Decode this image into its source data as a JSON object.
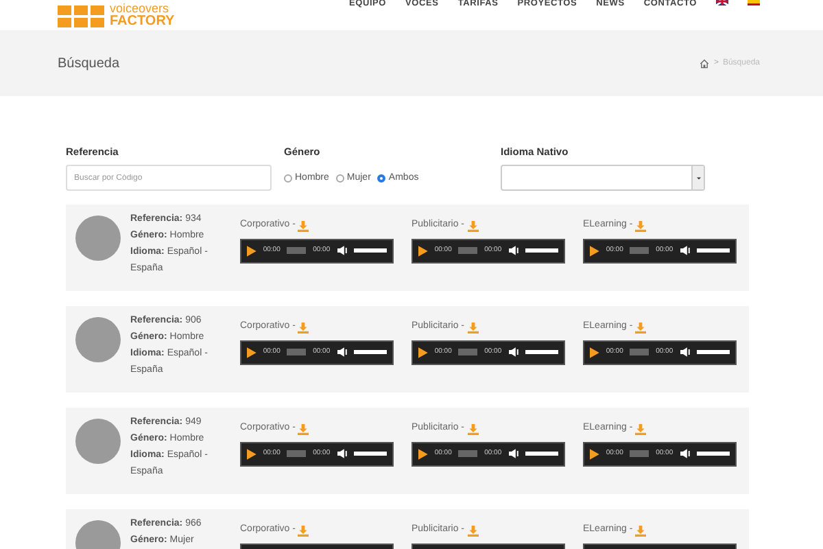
{
  "header": {
    "logo": {
      "line1": "voiceovers",
      "line2": "FACTORY"
    },
    "nav": [
      {
        "label": "EQUIPO"
      },
      {
        "label": "VOCES"
      },
      {
        "label": "TARIFAS"
      },
      {
        "label": "PROYECTOS"
      },
      {
        "label": "NEWS"
      },
      {
        "label": "CONTACTO"
      }
    ]
  },
  "page_title": "Búsqueda",
  "breadcrumb": {
    "separator": ">",
    "current": "Búsqueda"
  },
  "filters": {
    "referencia": {
      "label": "Referencia",
      "placeholder": "Buscar por Código"
    },
    "genero": {
      "label": "Género",
      "options": [
        {
          "label": "Hombre",
          "selected": false
        },
        {
          "label": "Mujer",
          "selected": false
        },
        {
          "label": "Ambos",
          "selected": true
        }
      ]
    },
    "idioma": {
      "label": "Idioma Nativo"
    }
  },
  "voices": [
    {
      "lines": [
        "**Referencia:** 934",
        "**Género:** Hombre",
        "**Idioma:** Español - España"
      ],
      "samples": [
        {
          "label": "Corporativo -",
          "current": "00:00",
          "duration": "00:00",
          "progress": {
            "level": 0
          },
          "volume": {
            "level": 1
          }
        },
        {
          "label": "Publicitario -",
          "current": "00:00",
          "duration": "00:00",
          "progress": {
            "level": 0
          },
          "volume": {
            "level": 1
          }
        },
        {
          "label": "ELearning -",
          "current": "00:00",
          "duration": "00:00",
          "progress": {
            "level": 0
          },
          "volume": {
            "level": 1
          }
        }
      ]
    },
    {
      "lines": [
        "**Referencia:** 906",
        "**Género:** Hombre",
        "**Idioma:** Español - España"
      ],
      "samples": [
        {
          "label": "Corporativo -",
          "current": "00:00",
          "duration": "00:00",
          "progress": {
            "level": 0
          },
          "volume": {
            "level": 1
          }
        },
        {
          "label": "Publicitario -",
          "current": "00:00",
          "duration": "00:00",
          "progress": {
            "level": 0
          },
          "volume": {
            "level": 1
          }
        },
        {
          "label": "ELearning -",
          "current": "00:00",
          "duration": "00:00",
          "progress": {
            "level": 0
          },
          "volume": {
            "level": 1
          }
        }
      ]
    },
    {
      "lines": [
        "**Referencia:** 949",
        "**Género:** Hombre",
        "**Idioma:** Español - España"
      ],
      "samples": [
        {
          "label": "Corporativo -",
          "current": "00:00",
          "duration": "00:00",
          "progress": {
            "level": 0
          },
          "volume": {
            "level": 1
          }
        },
        {
          "label": "Publicitario -",
          "current": "00:00",
          "duration": "00:00",
          "progress": {
            "level": 0
          },
          "volume": {
            "level": 1
          }
        },
        {
          "label": "ELearning -",
          "current": "00:00",
          "duration": "00:00",
          "progress": {
            "level": 0
          },
          "volume": {
            "level": 1
          }
        }
      ]
    },
    {
      "lines": [
        "**Referencia:** 966",
        "**Género:** Mujer"
      ],
      "samples": [
        {
          "label": "Corporativo -"
        },
        {
          "label": "Publicitario -"
        },
        {
          "label": "ELearning -"
        }
      ]
    }
  ]
}
